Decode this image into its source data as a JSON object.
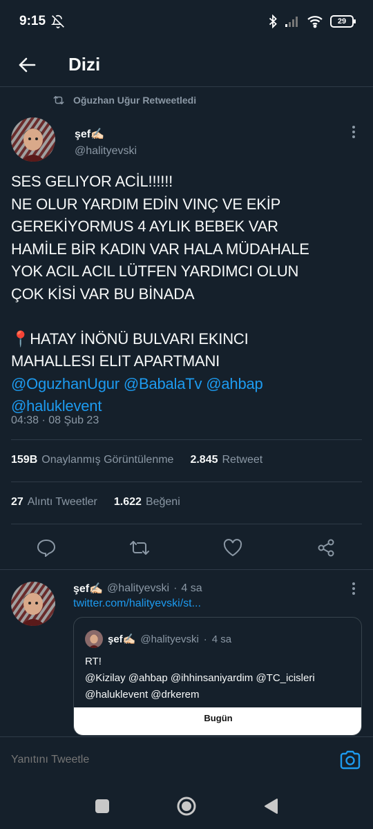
{
  "status_bar": {
    "time": "9:15",
    "battery": "29"
  },
  "header": {
    "title": "Dizi"
  },
  "retweet_context": {
    "text": "Oğuzhan Uğur Retweetledi"
  },
  "tweet": {
    "author_name": "şef✍🏻",
    "author_handle": "@halityevski",
    "text_lines": [
      "SES GELIYOR ACİL!!!!!!",
      "NE OLUR YARDIM EDİN VINÇ VE EKİP",
      "GEREKİYORMUS 4 AYLIK BEBEK VAR",
      "HAMİLE BİR KADIN VAR HALA MÜDAHALE",
      "YOK ACIL ACIL LÜTFEN YARDIMCI OLUN",
      "ÇOK KİSİ VAR BU BİNADA",
      "",
      "📍HATAY İNÖNÜ BULVARI EKINCI",
      "MAHALLESI ELIT APARTMANI"
    ],
    "mentions_line1": [
      "@OguzhanUgur",
      "@BabalaTv",
      "@ahbap"
    ],
    "mentions_line2": [
      "@haluklevent"
    ],
    "timestamp": "04:38 · 08 Şub 23",
    "views_count": "159B",
    "views_label": "Onaylanmış Görüntülenme",
    "retweets_count": "2.845",
    "retweets_label": "Retweet",
    "quotes_count": "27",
    "quotes_label": "Alıntı Tweetler",
    "likes_count": "1.622",
    "likes_label": "Beğeni"
  },
  "actions": {
    "reply_icon": "reply-icon",
    "retweet_icon": "retweet-icon",
    "like_icon": "heart-icon",
    "share_icon": "share-icon"
  },
  "reply": {
    "author_name": "şef✍🏻",
    "author_handle": "@halityevski",
    "time": "4 sa",
    "link": "twitter.com/halityevski/st...",
    "quote": {
      "author_name": "şef✍🏻",
      "author_handle": "@halityevski",
      "time": "4 sa",
      "line1": "RT!",
      "line2": "@Kizilay @ahbap @ihhinsaniyardim @TC_icisleri",
      "line3": "@haluklevent @drkerem",
      "media_label": "Bugün"
    }
  },
  "reply_bar": {
    "placeholder": "Yanıtını Tweetle"
  },
  "colors": {
    "background": "#15202b",
    "accent": "#1d9bf0",
    "secondary_text": "#8b98a5",
    "divider": "#2f3b48"
  }
}
